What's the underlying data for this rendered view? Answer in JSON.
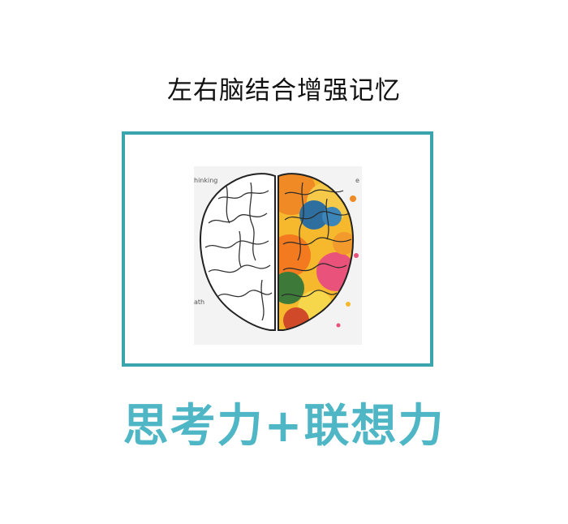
{
  "title": "左右脑结合增强记忆",
  "subtitle": "思考力+联想力",
  "illustration": {
    "icon": "left-right-brain-illustration",
    "left_label_top": "hinking",
    "left_label_bottom": "ath",
    "right_label_top": "e"
  },
  "colors": {
    "frame": "#3aa5ad",
    "subtitle": "#4fb6c6",
    "title": "#111111"
  }
}
